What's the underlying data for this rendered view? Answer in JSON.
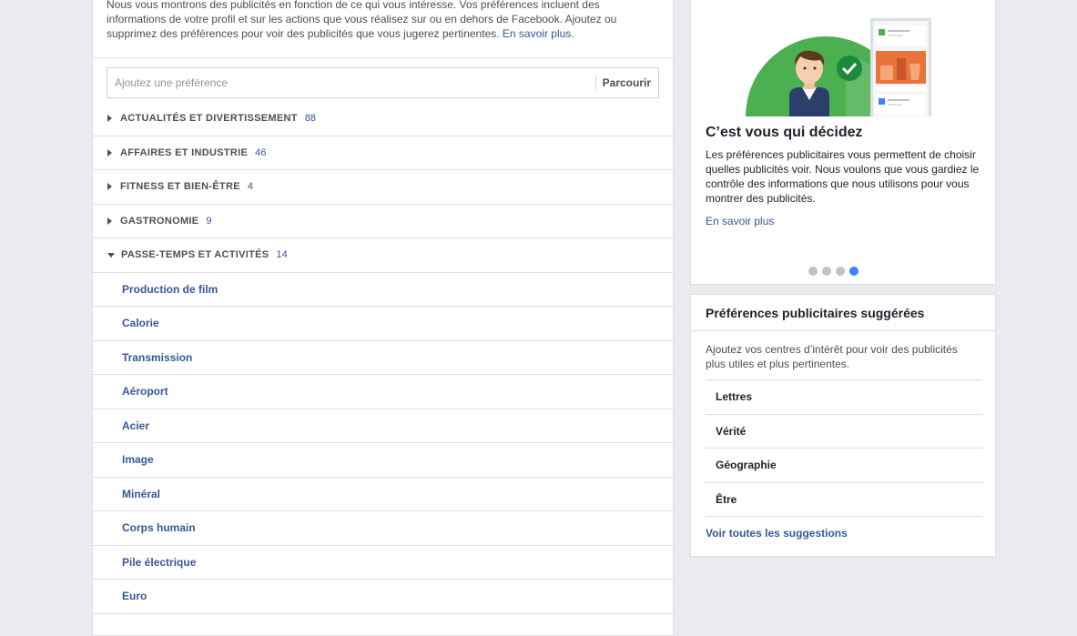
{
  "intro": {
    "text": "Nous vous montrons des publicités en fonction de ce qui vous intéresse. Vos préférences incluent des informations de votre profil et sur les actions que vous réalisez sur ou en dehors de Facebook. Ajoutez ou supprimez des préférences pour voir des publicités que vous jugerez pertinentes.",
    "link": "En savoir plus."
  },
  "search": {
    "placeholder": "Ajoutez une préférence",
    "browse_label": "Parcourir"
  },
  "categories": [
    {
      "label": "ACTUALITÉS ET DIVERTISSEMENT",
      "count": "88",
      "expanded": false
    },
    {
      "label": "AFFAIRES ET INDUSTRIE",
      "count": "46",
      "expanded": false
    },
    {
      "label": "FITNESS ET BIEN-ÊTRE",
      "count": "4",
      "expanded": false
    },
    {
      "label": "GASTRONOMIE",
      "count": "9",
      "expanded": false
    },
    {
      "label": "PASSE-TEMPS ET ACTIVITÉS",
      "count": "14",
      "expanded": true
    }
  ],
  "hobby_items": [
    "Production de film",
    "Calorie",
    "Transmission",
    "Aéroport",
    "Acier",
    "Image",
    "Minéral",
    "Corps humain",
    "Pile électrique",
    "Euro"
  ],
  "promo": {
    "title": "C’est vous qui décidez",
    "description": "Les préférences publicitaires vous permettent de choisir quelles publicités voir. Nous voulons que vous gardiez le contrôle des informations que nous utilisons pour vous montrer des publicités.",
    "link": "En savoir plus",
    "dots": 4,
    "active_dot": 4
  },
  "suggestions": {
    "title": "Préférences publicitaires suggérées",
    "description": "Ajoutez vos centres d’intérêt pour voir des publicités plus utiles et plus pertinentes.",
    "items": [
      "Lettres",
      "Vérité",
      "Géographie",
      "Être"
    ],
    "see_all": "Voir toutes les suggestions"
  },
  "colors": {
    "link": "#365899",
    "accent": "#4080ff",
    "illustration_green": "#4caf50",
    "illustration_orange": "#e8743b"
  }
}
